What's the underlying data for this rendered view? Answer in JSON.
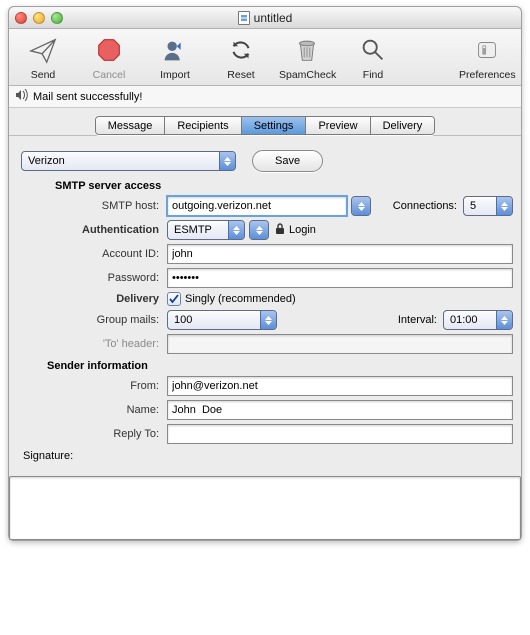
{
  "window": {
    "title": "untitled"
  },
  "toolbar": {
    "send": "Send",
    "cancel": "Cancel",
    "import": "Import",
    "reset": "Reset",
    "spamcheck": "SpamCheck",
    "find": "Find",
    "preferences": "Preferences"
  },
  "status": "Mail sent successfully!",
  "tabs": {
    "message": "Message",
    "recipients": "Recipients",
    "settings": "Settings",
    "preview": "Preview",
    "delivery": "Delivery",
    "selected": "settings"
  },
  "settings_panel": {
    "provider": "Verizon",
    "save_button": "Save",
    "sections": {
      "smtp_header": "SMTP server access",
      "sender_header": "Sender information"
    },
    "labels": {
      "smtp_host": "SMTP host:",
      "connections": "Connections:",
      "authentication": "Authentication",
      "login": "Login",
      "account_id": "Account ID:",
      "password": "Password:",
      "delivery": "Delivery",
      "singly": "Singly (recommended)",
      "group_mails": "Group mails:",
      "interval": "Interval:",
      "to_header": "'To' header:",
      "from": "From:",
      "name": "Name:",
      "reply_to": "Reply To:",
      "signature": "Signature:"
    },
    "values": {
      "smtp_host": "outgoing.verizon.net",
      "connections": "5",
      "auth_mode": "ESMTP",
      "account_id": "john",
      "password": "•••••••",
      "singly_checked": true,
      "group_mails": "100",
      "interval": "01:00",
      "to_header": "",
      "from": "john@verizon.net",
      "name": "John  Doe",
      "reply_to": "",
      "signature": ""
    }
  },
  "icons": {
    "close": "close-icon",
    "minimize": "minimize-icon",
    "zoom": "zoom-icon",
    "document": "document-icon",
    "send": "paperplane-icon",
    "cancel": "stop-octagon-icon",
    "import": "user-add-icon",
    "reset": "circular-arrows-icon",
    "spamcheck": "trashcan-icon",
    "find": "magnifier-icon",
    "preferences": "switch-icon",
    "sound": "sound-icon",
    "lock": "lock-icon",
    "checkmark": "checkmark-icon"
  }
}
